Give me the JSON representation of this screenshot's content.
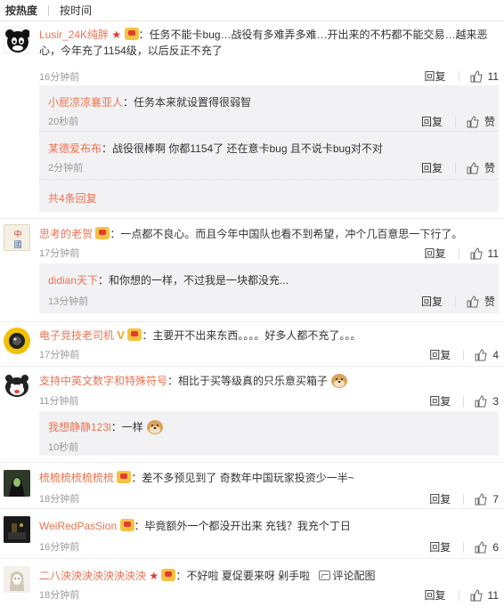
{
  "tabs": [
    {
      "label": "按热度",
      "active": true
    },
    {
      "label": "按时间",
      "active": false
    }
  ],
  "actions": {
    "reply_label": "回复",
    "like_label": "赞",
    "more_replies": "共4条回复",
    "comment_pic": "评论配图"
  },
  "comments": [
    {
      "user": "Lusir_24K纯胖",
      "text": "任务不能卡bug…战役有多难弄多难…开出来的不朽都不能交易…越来恶",
      "text2": "心，今年充了1154级，以后反正不充了",
      "time": "16分钟前",
      "likes": "11",
      "replies": [
        {
          "user": "小屁凉凉襄亚人",
          "text": "任务本来就设置得很弱智",
          "time": "20秒前"
        },
        {
          "user": "某德爱布布",
          "text": "战役很棒啊 你都1154了 还在意卡bug 且不说卡bug对不对",
          "time": "2分钟前"
        }
      ]
    },
    {
      "user": "思考的老贺",
      "text": "一点都不良心。而且今年中国队也看不到希望，冲个几百意思一下行了。",
      "time": "17分钟前",
      "likes": "11",
      "replies": [
        {
          "user": "didian天下",
          "text": "和你想的一样，不过我是一块都没充...",
          "time": "13分钟前"
        }
      ]
    },
    {
      "user": "电子竞技老司机",
      "text": "主要开不出来东西。。。。好多人都不充了。。。",
      "time": "17分钟前",
      "likes": "4"
    },
    {
      "user": "支持中英文数字和特殊符号",
      "text": "相比于买等级真的只乐意买箱子",
      "time": "11分钟前",
      "likes": "3",
      "replies": [
        {
          "user": "我想静静123l",
          "text": "一样",
          "time": "10秒前"
        }
      ]
    },
    {
      "user": "梳梳梳梳梳梳梳",
      "text": "差不多预见到了 奇数年中国玩家投资少一半~",
      "time": "18分钟前",
      "likes": "7"
    },
    {
      "user": "WeiRedPasSion",
      "text": "毕竟额外一个都没开出来 充钱？我充个丁日",
      "time": "16分钟前",
      "likes": "6"
    },
    {
      "user": "二八泱泱泱泱泱泱泱泱",
      "text": "不好啦 夏促要来呀 剁手啦",
      "time": "18分钟前",
      "likes": "11"
    }
  ],
  "colors": {
    "username": "#eb7350",
    "sub_bg": "#f2f2f5",
    "muted": "#999999"
  }
}
